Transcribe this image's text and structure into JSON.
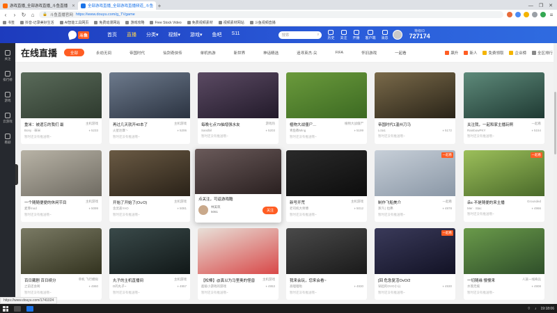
{
  "browser": {
    "tabs": [
      {
        "label": "游戏直播_全部游戏直播_斗鱼直播",
        "active": false
      },
      {
        "label": "全部游戏直播_全部游戏直播频道_斗鱼",
        "active": true
      }
    ],
    "new_tab": "+",
    "window_controls": [
      "—",
      "❐",
      "✕"
    ],
    "address": {
      "site": "斗鱼直播官网",
      "url": "https://www.douyu.com/g_TVgame"
    },
    "bookmarks": [
      "书签",
      "抖音-记录美好生活",
      "AI智能工具网页",
      "免费动漫网站",
      "游戏攻略",
      "Free Stock Video",
      "免费视频素材",
      "视频素材网站",
      "斗鱼视频直播"
    ]
  },
  "site": {
    "logo_text": "斗鱼",
    "nav": [
      {
        "label": "首页",
        "active": false
      },
      {
        "label": "直播",
        "active": true
      },
      {
        "label": "分类▾",
        "active": false
      },
      {
        "label": "视频▾",
        "active": false
      },
      {
        "label": "游戏▾",
        "active": false
      },
      {
        "label": "鱼吧",
        "active": false
      },
      {
        "label": "S11",
        "active": false
      }
    ],
    "search_placeholder": "搜索",
    "header_icons": [
      "历史",
      "关注",
      "开播",
      "客户端",
      "消息"
    ],
    "level_label": "等级ID",
    "level_value": "727174"
  },
  "sidebar": [
    "关注",
    "排行榜",
    "游戏",
    "云游戏",
    "看剧"
  ],
  "page": {
    "title": "在线直播",
    "categories": [
      {
        "label": "全部",
        "active": true
      },
      {
        "label": "永劫无间",
        "active": false
      },
      {
        "label": "帝国时代",
        "active": false
      },
      {
        "label": "仙剑奇侠传",
        "active": false
      },
      {
        "label": "单机热游",
        "active": false
      },
      {
        "label": "新世界",
        "active": false
      },
      {
        "label": "神话精选",
        "active": false
      },
      {
        "label": "追寻英杰·尖",
        "active": false
      },
      {
        "label": "FIFA",
        "active": false
      },
      {
        "label": "怀旧游戏",
        "active": false
      },
      {
        "label": "一起看",
        "active": false
      }
    ],
    "rank_links": [
      "飙升",
      "新人",
      "免费领取",
      "企业榜",
      "全区排行"
    ]
  },
  "cards": [
    {
      "title": "重米：被遗忘的我们 最",
      "category": "主机游戏",
      "streamer": "Bony · 罪米",
      "hot": "5233",
      "badge": ""
    },
    {
      "title": "再过几天就开40本了",
      "category": "主机游戏",
      "streamer": "火星达摩丶",
      "hot": "5206",
      "badge": ""
    },
    {
      "title": "每晚七点79抽增强水友",
      "category": "游戏热",
      "streamer": "Sandbil",
      "hot": "5203",
      "badge": ""
    },
    {
      "title": "植物大战僵尸…",
      "category": "植物大战僵尸",
      "streamer": "青鱼教Ming",
      "hot": "5199",
      "badge": ""
    },
    {
      "title": "帝国时代1温州刀马",
      "category": "",
      "streamer": "Lcta1",
      "hot": "5172",
      "badge": ""
    },
    {
      "title": "关注我，一起和家主播玩啊",
      "category": "一起看",
      "streamer": "RainbowPKY",
      "hot": "5154",
      "badge": ""
    },
    {
      "title": "一个随随便便的休闲节目",
      "category": "主机游戏",
      "streamer": "麦芽mod",
      "hot": "5099",
      "badge": ""
    },
    {
      "title": "开始了开始了(O∪O)",
      "category": "主机游戏",
      "streamer": "含灵盖YAO",
      "hot": "5081",
      "badge": ""
    },
    {
      "title": "新号开荒",
      "category": "主机游戏",
      "streamer": "老司机大师傅",
      "hot": "5012",
      "badge": ""
    },
    {
      "title": "制作飞船美介",
      "category": "一起看",
      "streamer": "蒸汽 | 拉弗",
      "hot": "4978",
      "badge": "一起看"
    },
    {
      "title": "朵ε·不是随便的来主播",
      "category": "Grounded",
      "streamer": "Mer · Stac",
      "hot": "4966",
      "badge": "一起看"
    },
    {
      "title": "百日藏剧 百日续分",
      "category": "单机 飞行模拟",
      "streamer": "之前还会啊",
      "hot": "4960",
      "badge": ""
    },
    {
      "title": "丸子的主机直播间",
      "category": "主机游戏",
      "streamer": "D的丸子~",
      "hot": "4957",
      "badge": ""
    },
    {
      "title": "【松棒】@真以为马里奥的怪兽",
      "category": "主机游戏",
      "streamer": "超级小游戏的游戏",
      "hot": "4953",
      "badge": ""
    },
    {
      "title": "我来会玩，您来会看~",
      "category": "",
      "streamer": "高哩哩啦",
      "hot": "4930",
      "badge": ""
    },
    {
      "title": "[回 危急复活OvO/2",
      "category": "",
      "streamer": "早起的OVO小公",
      "hot": "4930",
      "badge": "一起看"
    },
    {
      "title": "一切随缘 慢慢来",
      "category": "人族一线奇兵",
      "streamer": "水落无痕",
      "hot": "4908",
      "badge": ""
    }
  ],
  "hover_card": {
    "title": "点关注，可返游戏酷",
    "streamer": "林美筑",
    "hot": "5061",
    "follow": "关注"
  },
  "card_footer": "暂时还没有推送哦~",
  "status_url": "https://www.douyu.com/1741024",
  "taskbar": {
    "time": "19:18:06"
  }
}
